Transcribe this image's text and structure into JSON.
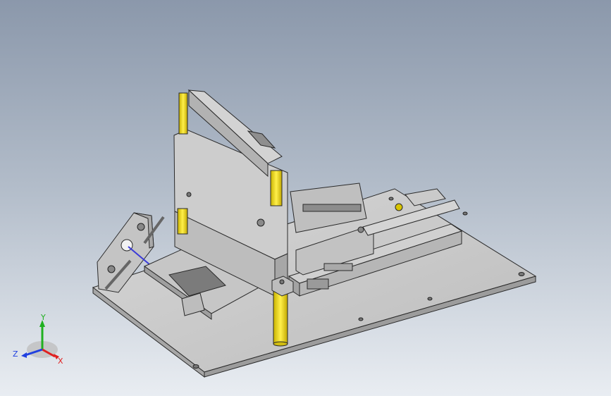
{
  "viewport": {
    "colors": {
      "bg_top": "#8b98ab",
      "bg_bottom": "#e9edf2",
      "metal": "#c9c9c9",
      "metal_dark": "#9a9a9a",
      "outline": "#2a2a2a",
      "accent_yellow": "#f4e22a",
      "rod_blue": "#3a3ad8"
    }
  },
  "triad": {
    "x_label": "X",
    "y_label": "Y",
    "z_label": "Z",
    "colors": {
      "x": "#e02020",
      "y": "#20b020",
      "z": "#2040e0"
    }
  }
}
